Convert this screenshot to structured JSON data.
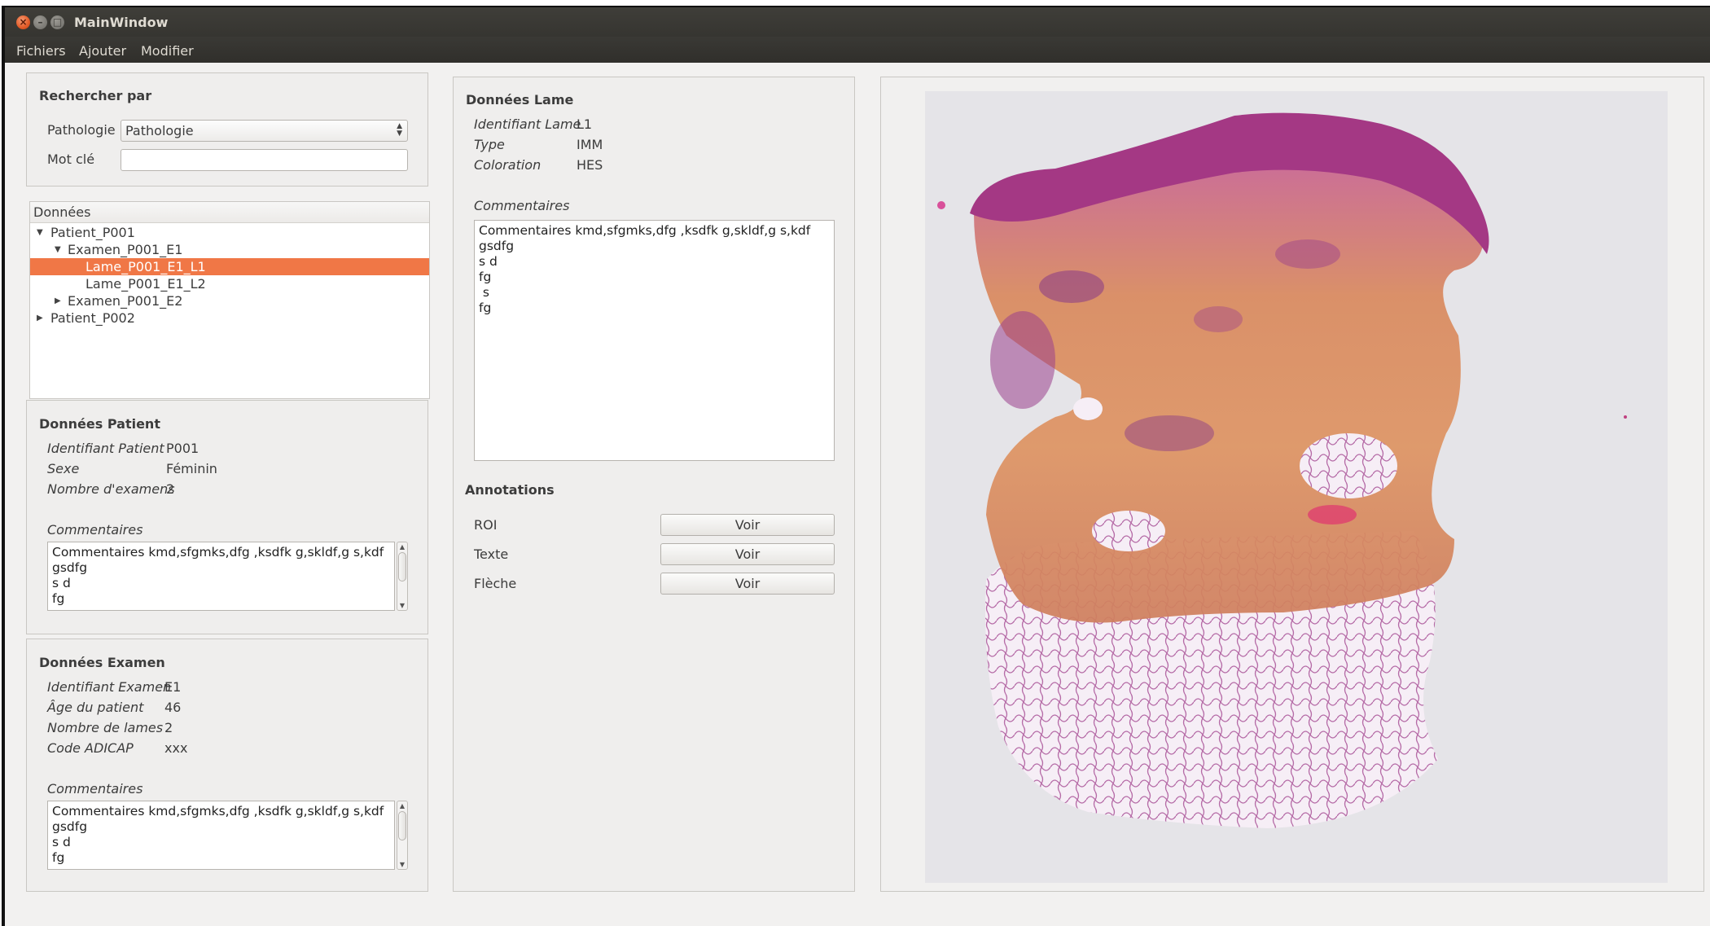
{
  "window": {
    "title": "MainWindow",
    "close_glyph": "×",
    "min_glyph": "–",
    "max_glyph": "□"
  },
  "menu": {
    "items": [
      "Fichiers",
      "Ajouter",
      "Modifier"
    ]
  },
  "search": {
    "title": "Rechercher par",
    "pathologie_label": "Pathologie",
    "pathologie_value": "Pathologie",
    "motcle_label": "Mot clé",
    "motcle_value": ""
  },
  "tree": {
    "header": "Données",
    "rows": [
      {
        "label": "Patient_P001",
        "expander": "▼"
      },
      {
        "label": "Examen_P001_E1",
        "expander": "▼"
      },
      {
        "label": "Lame_P001_E1_L1",
        "expander": ""
      },
      {
        "label": "Lame_P001_E1_L2",
        "expander": ""
      },
      {
        "label": "Examen_P001_E2",
        "expander": "▶"
      },
      {
        "label": "Patient_P002",
        "expander": "▶"
      }
    ],
    "selected_index": 2
  },
  "patient": {
    "title": "Données Patient",
    "fields": [
      {
        "label": "Identifiant Patient",
        "value": "P001"
      },
      {
        "label": "Sexe",
        "value": "Féminin"
      },
      {
        "label": "Nombre d'examens",
        "value": "2"
      }
    ],
    "comments_label": "Commentaires",
    "comments_lines": [
      "Commentaires kmd,sfgmks,dfg ,ksdfk g,skldf,g s,kdf",
      "gsdfg",
      "s d",
      "fg"
    ]
  },
  "examen": {
    "title": "Données Examen",
    "fields": [
      {
        "label": "Identifiant Examen",
        "value": "E1"
      },
      {
        "label": "Âge du patient",
        "value": "46"
      },
      {
        "label": "Nombre de lames",
        "value": "2"
      },
      {
        "label": "Code ADICAP",
        "value": "xxx"
      }
    ],
    "comments_label": "Commentaires",
    "comments_lines": [
      "Commentaires kmd,sfgmks,dfg ,ksdfk g,skldf,g s,kdf",
      "gsdfg",
      "s d",
      "fg"
    ]
  },
  "lame": {
    "title": "Données Lame",
    "fields": [
      {
        "label": "Identifiant Lame",
        "value": "L1"
      },
      {
        "label": "Type",
        "value": "IMM"
      },
      {
        "label": "Coloration",
        "value": "HES"
      }
    ],
    "comments_label": "Commentaires",
    "comments_lines": [
      "Commentaires kmd,sfgmks,dfg ,ksdfk g,skldf,g s,kdf",
      "gsdfg",
      "s d",
      "fg",
      " s",
      "fg"
    ]
  },
  "annotations": {
    "title": "Annotations",
    "rows": [
      {
        "label": "ROI",
        "button": "Voir"
      },
      {
        "label": "Texte",
        "button": "Voir"
      },
      {
        "label": "Flèche",
        "button": "Voir"
      }
    ]
  },
  "colors": {
    "selection": "#f07746",
    "tissue_pink": "#c25aa0",
    "tissue_orange": "#d98a55"
  }
}
